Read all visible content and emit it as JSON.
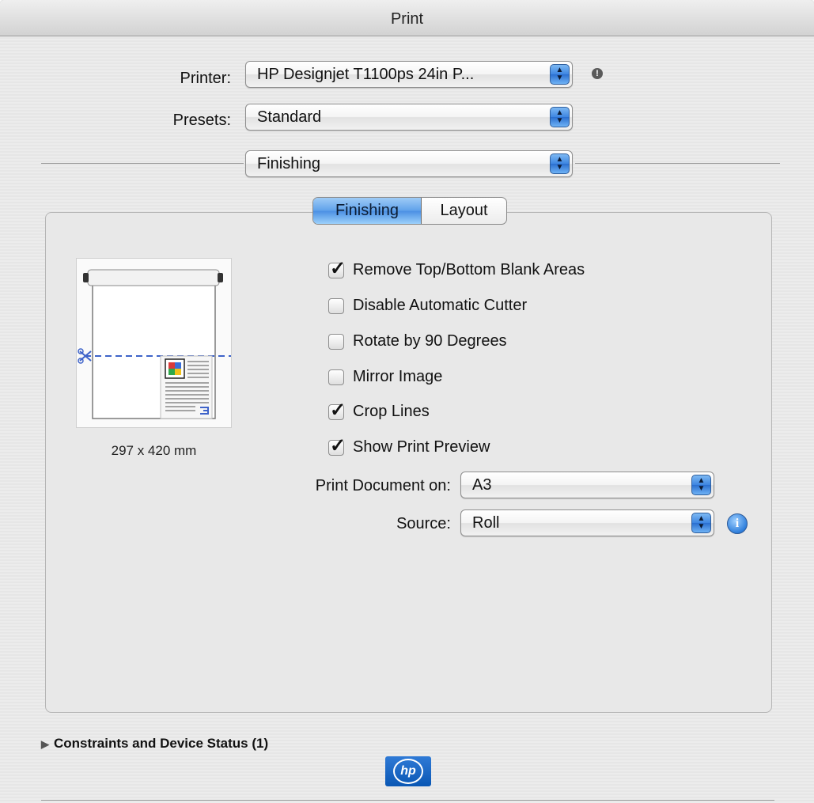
{
  "window": {
    "title": "Print"
  },
  "printer": {
    "label": "Printer:",
    "value": "HP Designjet T1100ps 24in P..."
  },
  "presets": {
    "label": "Presets:",
    "value": "Standard"
  },
  "pane_selector": {
    "value": "Finishing"
  },
  "tabs": [
    {
      "label": "Finishing",
      "selected": true
    },
    {
      "label": "Layout",
      "selected": false
    }
  ],
  "preview": {
    "size_label": "297 x 420 mm"
  },
  "options": [
    {
      "label": "Remove Top/Bottom Blank Areas",
      "checked": true
    },
    {
      "label": "Disable Automatic Cutter",
      "checked": false
    },
    {
      "label": "Rotate by 90 Degrees",
      "checked": false
    },
    {
      "label": "Mirror Image",
      "checked": false
    },
    {
      "label": "Crop Lines",
      "checked": true
    },
    {
      "label": "Show Print Preview",
      "checked": true
    }
  ],
  "print_document_on": {
    "label": "Print Document on:",
    "value": "A3"
  },
  "source": {
    "label": "Source:",
    "value": "Roll"
  },
  "constraints": {
    "label": "Constraints and Device Status (1)"
  },
  "branding": {
    "logo_text": "hp"
  },
  "icons": {
    "warning": "exclamation-icon",
    "info": "info-icon",
    "disclosure": "disclosure-triangle-icon",
    "popup_arrows": "updown-arrows-icon"
  },
  "colors": {
    "accent": "#3d86e1",
    "tab_selected": "#5ea1ea",
    "hp_blue": "#0a57b4"
  }
}
